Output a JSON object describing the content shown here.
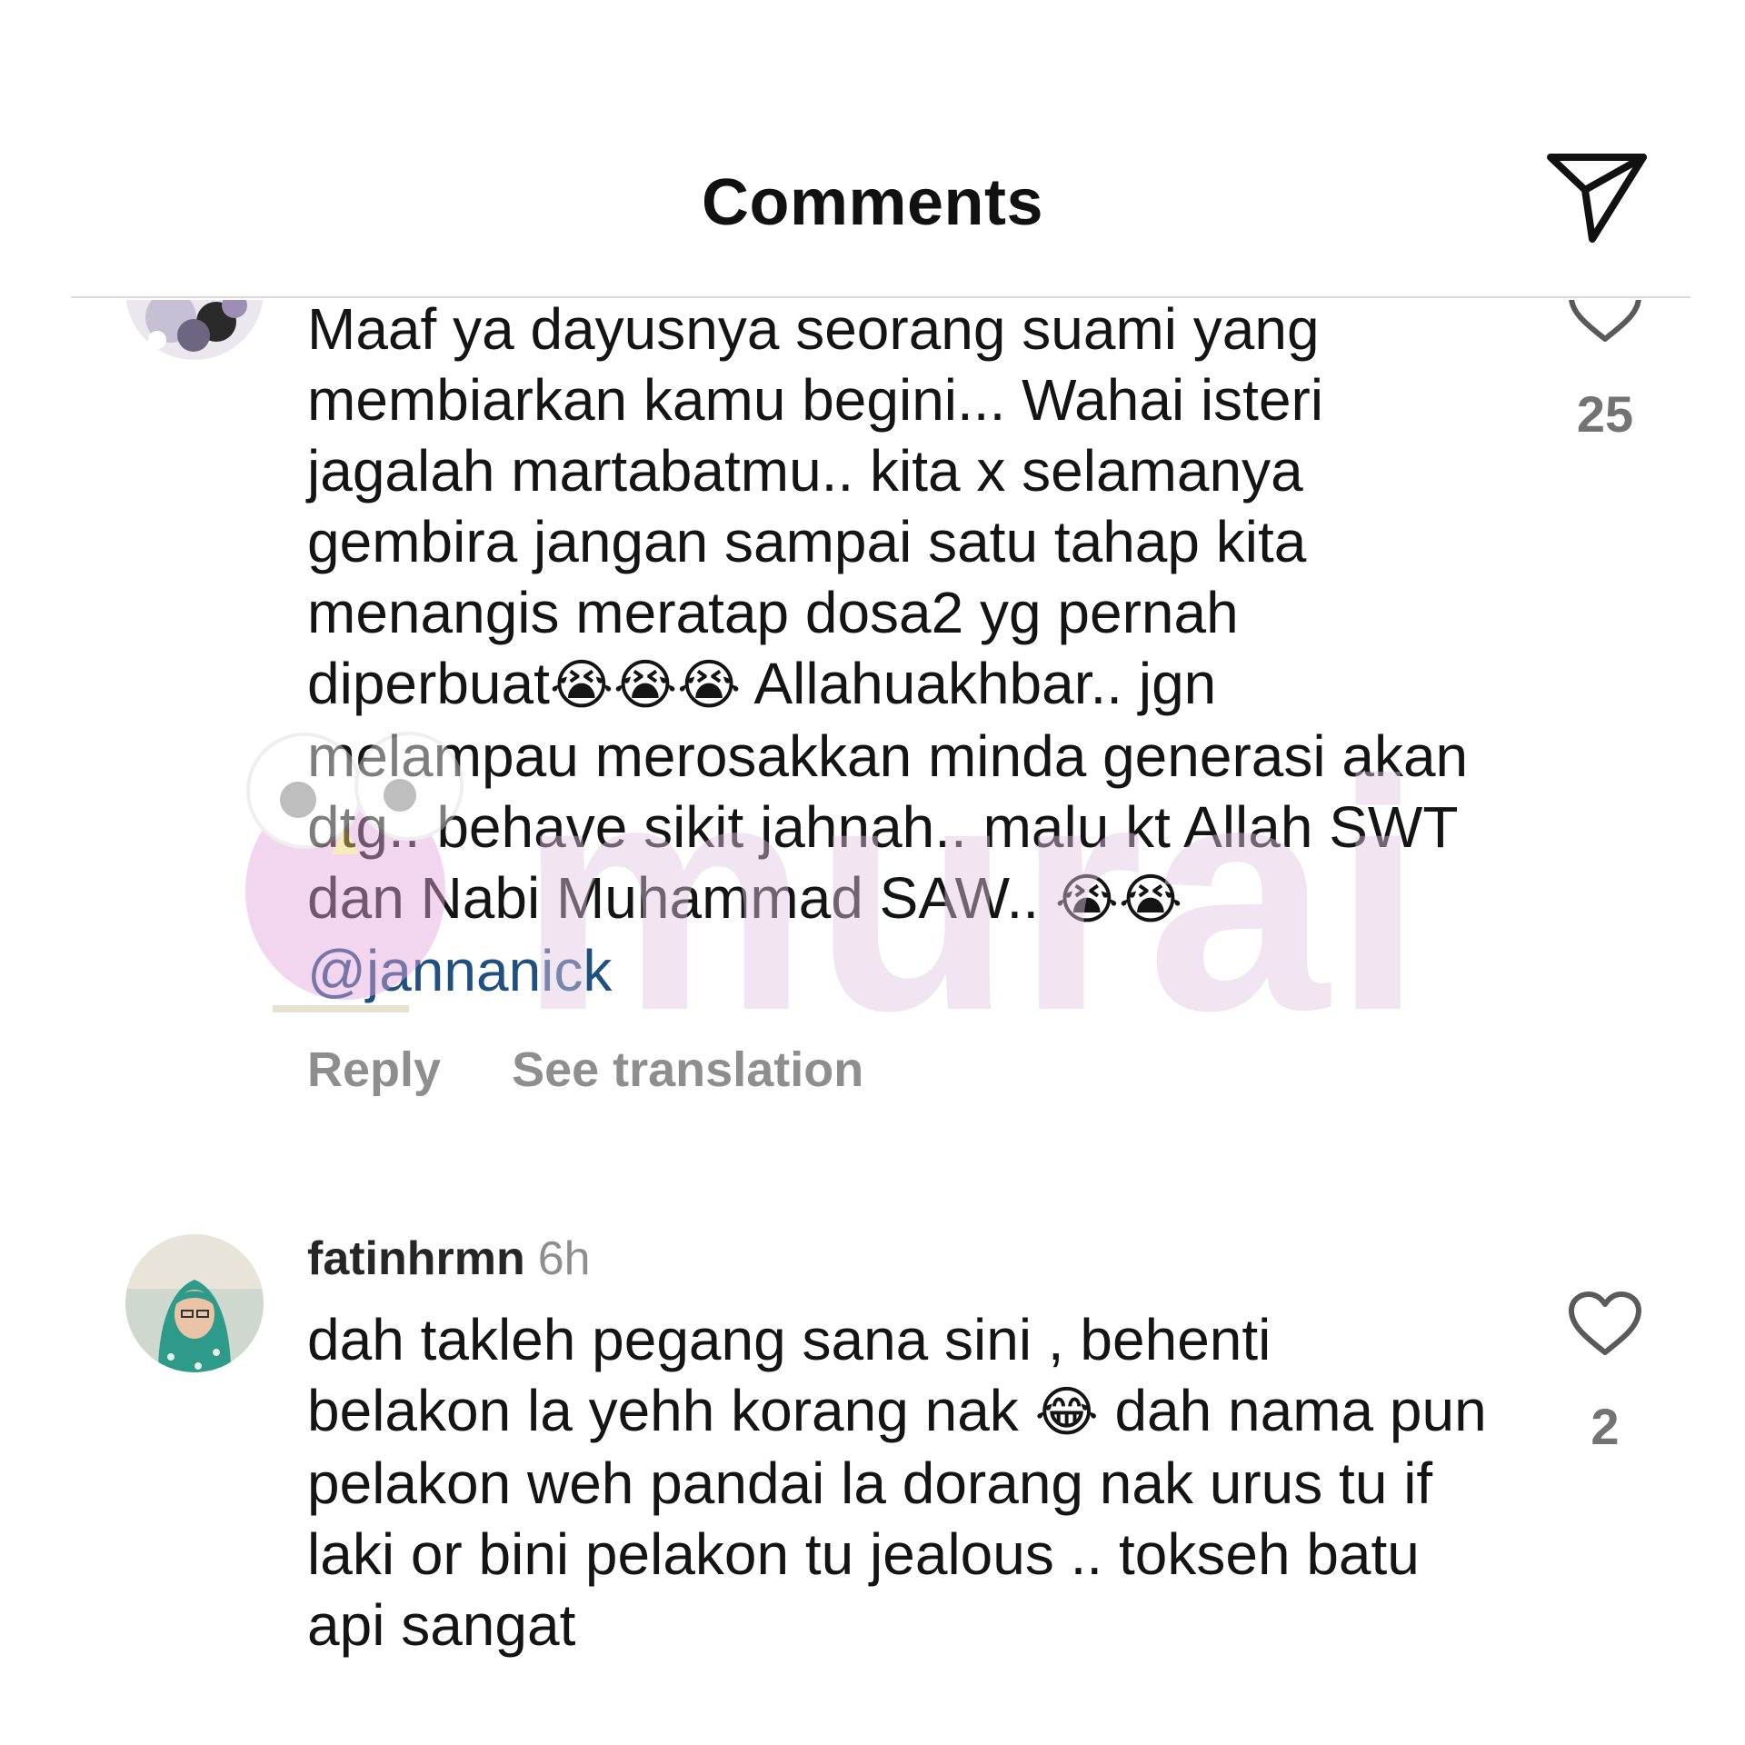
{
  "header": {
    "title": "Comments",
    "share_icon": "paper-plane-icon"
  },
  "comments": [
    {
      "text_before": "Maaf ya dayusnya seorang suami yang membiarkan kamu begini... Wahai isteri jagalah martabatmu.. kita x selamanya gembira jangan sampai satu tahap kita menangis meratap dosa2 yg pernah diperbuat",
      "emojis_1": "😭😭😭",
      "text_middle": " Allahuakhbar.. jgn melampau merosakkan minda generasi akan dtg.. behave sikit jahnah.. malu kt Allah SWT dan Nabi Muhammad SAW.. ",
      "emojis_2": "😭😭",
      "mention": "@jannanick",
      "likes": "25",
      "reply_label": "Reply",
      "translate_label": "See translation"
    },
    {
      "username": "fatinhrmn",
      "time": "6h",
      "text_before": "dah takleh pegang sana sini , behenti belakon la yehh korang nak ",
      "emoji": "😂",
      "text_after": " dah nama pun pelakon weh pandai la dorang nak urus tu if laki or bini pelakon tu jealous .. tokseh batu api sangat",
      "likes": "2"
    }
  ],
  "watermark": {
    "text": "murai"
  },
  "colors": {
    "mention": "#20507f",
    "muted": "#8e8e8e",
    "watermark": "#e3c6e3"
  }
}
